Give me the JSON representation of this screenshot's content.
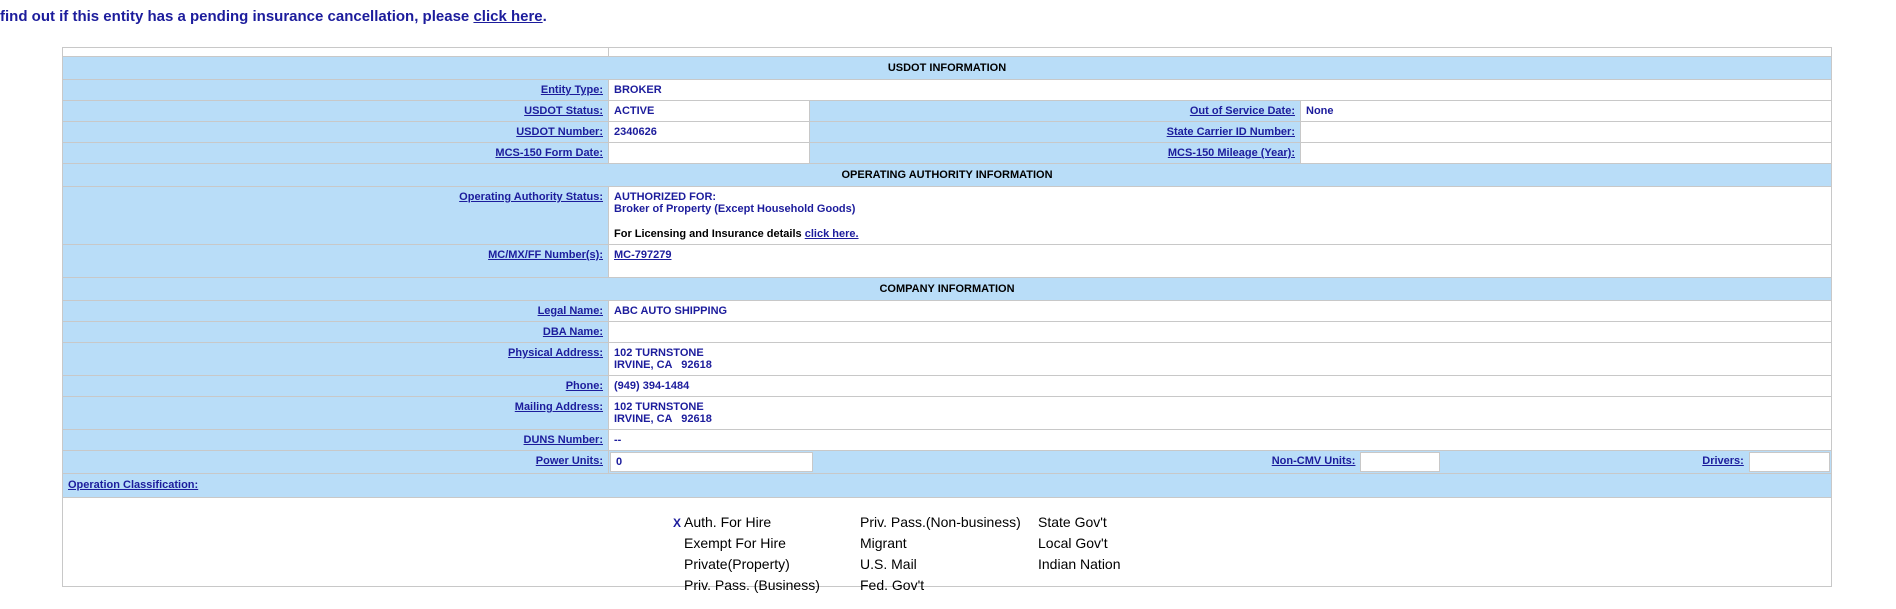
{
  "banner": {
    "text": "find out if this entity has a pending insurance cancellation, please ",
    "link": "click here",
    "suffix": "."
  },
  "usdot": {
    "header": "USDOT INFORMATION",
    "entity_type_label": "Entity Type:",
    "entity_type": "BROKER",
    "status_label": "USDOT Status:",
    "status": "ACTIVE",
    "oos_label": "Out of Service Date:",
    "oos": "None",
    "number_label": "USDOT Number:",
    "number": "2340626",
    "state_id_label": "State Carrier ID Number:",
    "state_id": "",
    "mcs150_label": "MCS-150 Form Date:",
    "mcs150": "",
    "mileage_label": "MCS-150 Mileage (Year):",
    "mileage": ""
  },
  "authority": {
    "header": "OPERATING AUTHORITY INFORMATION",
    "status_label": "Operating Authority Status:",
    "line1": "AUTHORIZED FOR:",
    "line2": "Broker of Property (Except Household Goods)",
    "details_text": "For Licensing and Insurance details ",
    "details_link": "click here.",
    "mc_label": "MC/MX/FF Number(s):",
    "mc": "MC-797279"
  },
  "company": {
    "header": "COMPANY INFORMATION",
    "legal_label": "Legal Name:",
    "legal": "ABC AUTO SHIPPING",
    "dba_label": "DBA Name:",
    "dba": "",
    "physical_label": "Physical Address:",
    "physical_line1": "102 TURNSTONE",
    "physical_line2": "IRVINE, CA   92618",
    "phone_label": "Phone:",
    "phone": "(949) 394-1484",
    "mailing_label": "Mailing Address:",
    "mailing_line1": "102 TURNSTONE",
    "mailing_line2": "IRVINE, CA   92618",
    "duns_label": "DUNS Number:",
    "duns": "--",
    "power_label": "Power Units:",
    "power": "0",
    "noncmv_label": "Non-CMV Units:",
    "noncmv": "",
    "drivers_label": "Drivers:",
    "drivers": ""
  },
  "operation": {
    "label": "Operation Classification:",
    "col1": [
      {
        "mark": "X",
        "text": "Auth. For Hire"
      },
      {
        "mark": "",
        "text": "Exempt For Hire"
      },
      {
        "mark": "",
        "text": "Private(Property)"
      },
      {
        "mark": "",
        "text": "Priv. Pass. (Business)"
      }
    ],
    "col2": [
      "Priv. Pass.(Non-business)",
      "Migrant",
      "U.S. Mail",
      "Fed. Gov't"
    ],
    "col3": [
      "State Gov't",
      "Local Gov't",
      "Indian Nation"
    ]
  }
}
